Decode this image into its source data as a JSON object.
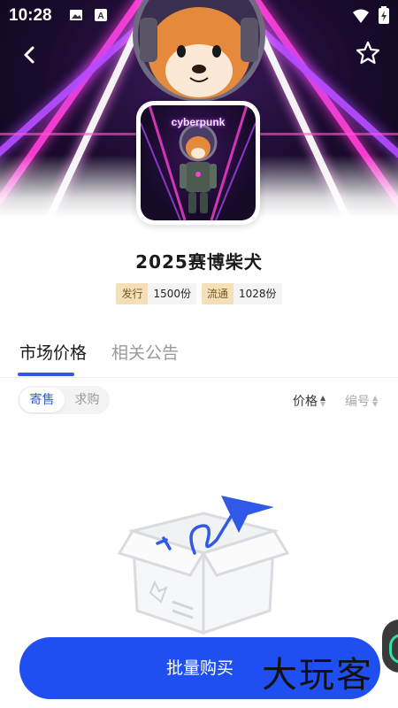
{
  "status_bar": {
    "time": "10:28"
  },
  "hero": {
    "thumb_caption": "cyberpunk"
  },
  "collection": {
    "title": "2025赛博柴犬",
    "issue": {
      "label": "发行",
      "value": "1500份"
    },
    "circulation": {
      "label": "流通",
      "value": "1028份"
    }
  },
  "tabs": [
    {
      "label": "市场价格",
      "active": true
    },
    {
      "label": "相关公告",
      "active": false
    }
  ],
  "filter": {
    "segments": [
      {
        "label": "寄售",
        "active": true
      },
      {
        "label": "求购",
        "active": false
      }
    ],
    "sort_price": "价格",
    "sort_number": "编号"
  },
  "actions": {
    "bulk_buy": "批量购买"
  },
  "watermark": "大玩客",
  "colors": {
    "accent": "#2f59e6",
    "button": "#1f4ff0",
    "badge_key": "#f3dfb8"
  }
}
